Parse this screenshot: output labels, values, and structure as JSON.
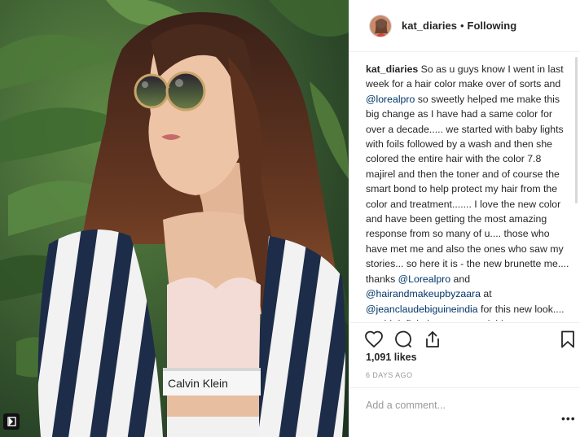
{
  "post": {
    "username": "kat_diaries",
    "separator": "•",
    "follow_status": "Following"
  },
  "caption": {
    "username": "kat_diaries",
    "text_1": " So as u guys know I went in last week for a hair color make over of sorts and ",
    "mention_1": "@lorealpro",
    "text_2": " so sweetly helped me make this big change as I have had a same color for over a decade..... we started with baby lights with foils followed by a wash and then she colored the entire hair with the color 7.8 majirel and then the toner and of course the smart bond to help protect my hair from the color and treatment....... I love the new color and have been getting the most amazing response from so many of u.... those who have met me and also the ones who saw my stories... so here it is - the new brunette me.... thanks ",
    "mention_2": "@Lorealpro",
    "text_3": " and ",
    "mention_3": "@hairandmakeupbyzaara",
    "text_4": " at ",
    "mention_4": "@jeanclaudebiguineindia",
    "text_5": " for this new look.... would definitely recommend this to anyone who is looking to color their hair."
  },
  "photo": {
    "bra_brand": "Calvin Klein"
  },
  "icons": {
    "like": "heart-icon",
    "comment": "comment-icon",
    "share": "share-icon",
    "save": "bookmark-icon",
    "multi": "multiple-posts-icon"
  },
  "stats": {
    "likes": "1,091 likes",
    "time_ago": "6 DAYS AGO"
  },
  "comment": {
    "placeholder": "Add a comment...",
    "more": "•••"
  }
}
